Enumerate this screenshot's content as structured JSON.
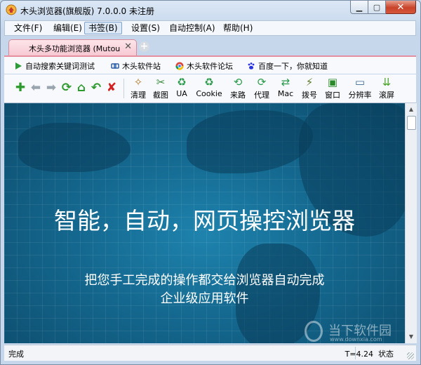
{
  "window": {
    "title": "木头浏览器(旗舰版) 7.0.0.0  未注册",
    "controls": {
      "minimize": "▁",
      "maximize": "▢",
      "close": "✕"
    }
  },
  "menu": [
    {
      "label": "文件(F)"
    },
    {
      "label": "编辑(E)"
    },
    {
      "label": "书签(B)",
      "active": true
    },
    {
      "label": "设置(S)"
    },
    {
      "label": "自动控制(A)"
    },
    {
      "label": "帮助(H)"
    }
  ],
  "tabs": {
    "active_label": "木头多功能浏览器 (Mutou",
    "close_glyph": "✕",
    "add_glyph": "+"
  },
  "bookmarks": [
    {
      "label": "自动搜索关键词测试",
      "icon": "play-icon"
    },
    {
      "label": "木头软件站",
      "icon": "link-icon"
    },
    {
      "label": "木头软件论坛",
      "icon": "chrome-icon"
    },
    {
      "label": "百度一下，你就知道",
      "icon": "baidu-paw-icon"
    }
  ],
  "toolbar": {
    "nav": [
      {
        "icon": "add-icon",
        "glyph": "✚"
      },
      {
        "icon": "back-arrow-icon",
        "glyph": "⬅"
      },
      {
        "icon": "forward-arrow-icon",
        "glyph": "➡"
      },
      {
        "icon": "refresh-icon",
        "glyph": "⟳"
      },
      {
        "icon": "home-icon",
        "glyph": "⌂"
      },
      {
        "icon": "undo-icon",
        "glyph": "↶"
      },
      {
        "icon": "stop-icon",
        "glyph": "✘"
      }
    ],
    "tools": [
      {
        "label": "清理",
        "icon": "broom-icon",
        "glyph": "🧹"
      },
      {
        "label": "截图",
        "icon": "scissors-icon",
        "glyph": "✂"
      },
      {
        "label": "UA",
        "icon": "recycle-icon",
        "glyph": "♻"
      },
      {
        "label": "Cookie",
        "icon": "cookie-recycle-icon",
        "glyph": "♻"
      },
      {
        "label": "来路",
        "icon": "source-icon",
        "glyph": "⟲"
      },
      {
        "label": "代理",
        "icon": "proxy-icon",
        "glyph": "⟳"
      },
      {
        "label": "Mac",
        "icon": "mac-icon",
        "glyph": "⇄"
      },
      {
        "label": "拨号",
        "icon": "dial-plug-icon",
        "glyph": "⚡"
      },
      {
        "label": "窗口",
        "icon": "window-icon",
        "glyph": "▣"
      },
      {
        "label": "分辨率",
        "icon": "monitor-icon",
        "glyph": "🖥"
      },
      {
        "label": "滚屏",
        "icon": "scroll-down-icon",
        "glyph": "⇊"
      }
    ],
    "colors": {
      "nav_green": "#2c9a2c",
      "nav_gray": "#9aa4ae",
      "stop_red": "#d42020"
    }
  },
  "content": {
    "title": "智能，自动，网页操控浏览器",
    "subtitle_line1": "把您手工完成的操作都交给浏览器自动完成",
    "subtitle_line2": "企业级应用软件",
    "watermark_name": "当下软件园",
    "watermark_url": "www.downxia.com"
  },
  "status": {
    "left": "完成",
    "timing": "T=4.24",
    "state_label": "状态"
  }
}
